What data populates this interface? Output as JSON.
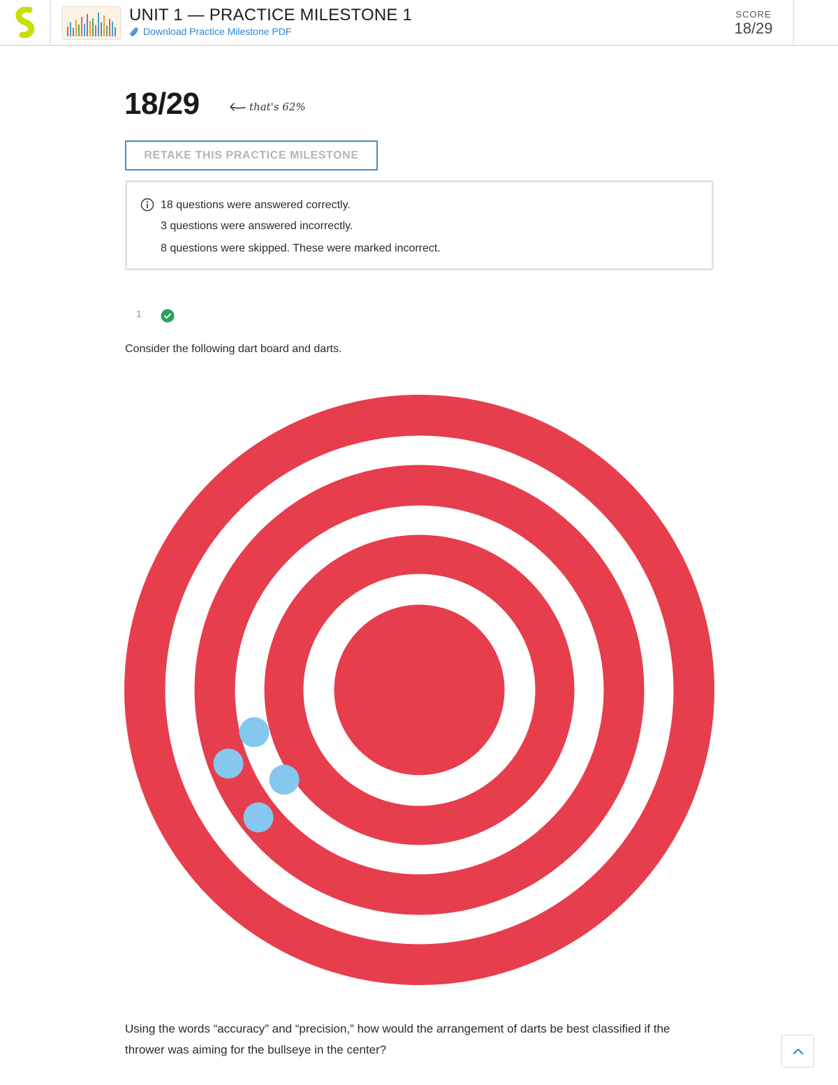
{
  "header": {
    "unit_title": "UNIT 1 — PRACTICE MILESTONE 1",
    "download_link": "Download Practice Milestone PDF",
    "score_label": "SCORE",
    "score_value": "18/29"
  },
  "result": {
    "score": "18/29",
    "percent_note": "that's 62%",
    "retake_button": "RETAKE THIS PRACTICE MILESTONE"
  },
  "summary": {
    "correct": "18 questions were answered correctly.",
    "incorrect": "3 questions were answered incorrectly.",
    "skipped": "8 questions were skipped. These were marked incorrect."
  },
  "question": {
    "number": "1",
    "status": "correct",
    "text": "Consider the following dart board and darts.",
    "prompt": "Using the words “accuracy” and “precision,” how would the arrangement of darts be best classified if the thrower was aiming for the bullseye in the center?"
  },
  "dartboard": {
    "ring_color": "#e63e4c",
    "dart_color": "#84c8ef",
    "dart_count": 4
  },
  "colors": {
    "brand_logo": "#c8e000",
    "link": "#2a84d6",
    "retake_border": "#3d8fc9",
    "correct": "#2aa05a"
  }
}
